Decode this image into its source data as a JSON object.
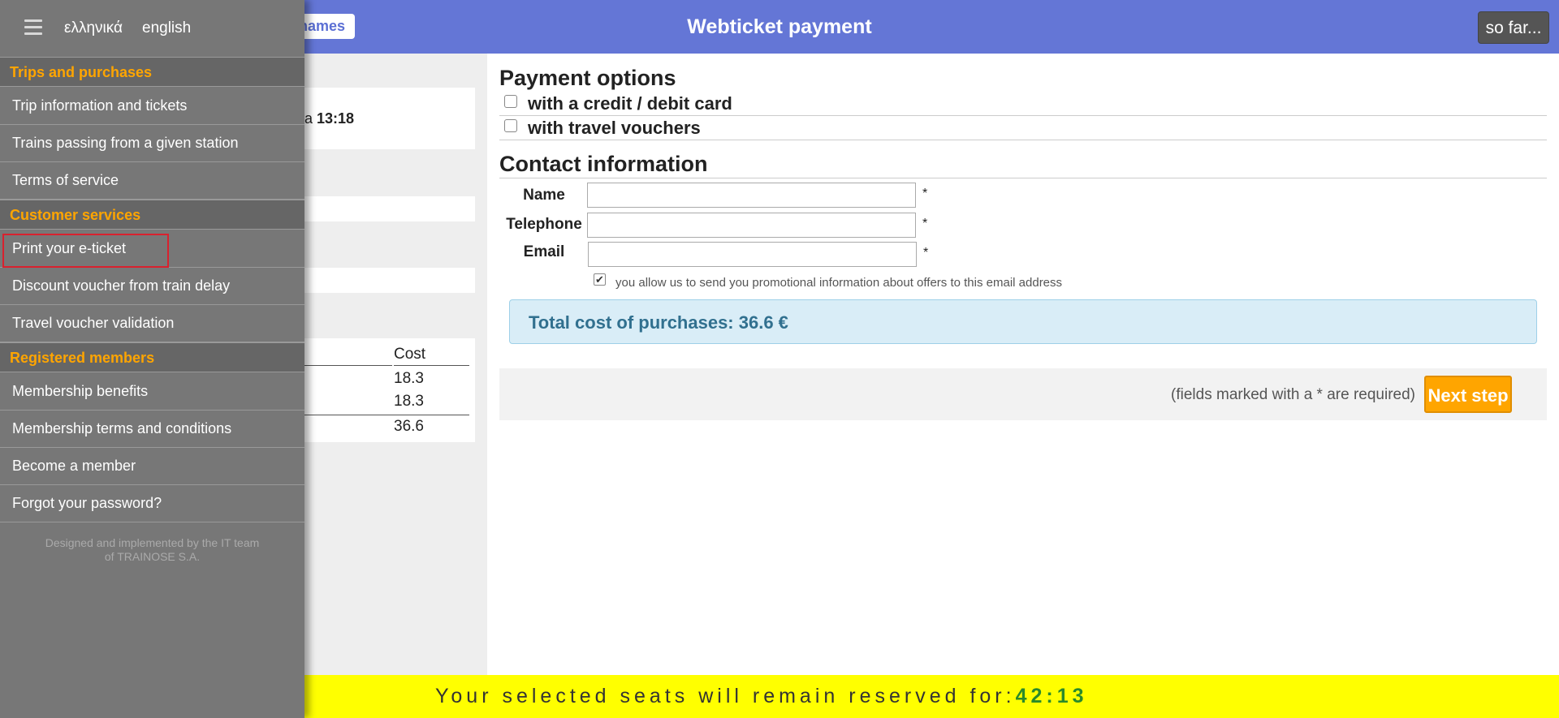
{
  "header": {
    "title": "Webticket payment",
    "names_button": "names",
    "sofar_button": "so far..."
  },
  "left_panel": {
    "time_prefix": "a",
    "time_value": "13:18",
    "cost_header": "Cost",
    "costs": [
      "18.3",
      "18.3"
    ],
    "cost_total": "36.6"
  },
  "payment": {
    "title": "Payment options",
    "options": [
      "with a credit / debit card",
      "with travel vouchers"
    ]
  },
  "contact": {
    "title": "Contact information",
    "fields": [
      {
        "label": "Name",
        "value": "",
        "required": "*"
      },
      {
        "label": "Telephone",
        "value": "",
        "required": "*"
      },
      {
        "label": "Email",
        "value": "",
        "required": "*"
      }
    ],
    "promo_checked": true,
    "promo_text": "you allow us to send you promotional information about offers to this email address"
  },
  "total": {
    "text": "Total cost of purchases: 36.6 €"
  },
  "actions": {
    "required_note": "(fields marked with a * are required)",
    "next_button": "Next step"
  },
  "reservation": {
    "text": "Your selected seats will remain reserved for:",
    "timer": "42:13"
  },
  "sidemenu": {
    "languages": [
      "ελληνικά",
      "english"
    ],
    "groups": [
      {
        "title": "Trips and purchases",
        "items": [
          "Trip information and tickets",
          "Trains passing from a given station",
          "Terms of service"
        ]
      },
      {
        "title": "Customer services",
        "items": [
          "Print your e-ticket",
          "Discount voucher from train delay",
          "Travel voucher validation"
        ]
      },
      {
        "title": "Registered members",
        "items": [
          "Membership benefits",
          "Membership terms and conditions",
          "Become a member",
          "Forgot your password?"
        ]
      }
    ],
    "footer_line1": "Designed and implemented by the IT team",
    "footer_line2": "of TRAINOSE S.A.",
    "selected_item": "Print your e-ticket"
  },
  "colors": {
    "header_bg": "#6476d6",
    "accent_orange": "#ffa500",
    "reserve_bar": "#ffff00",
    "timer_green": "#2a8a2a"
  }
}
